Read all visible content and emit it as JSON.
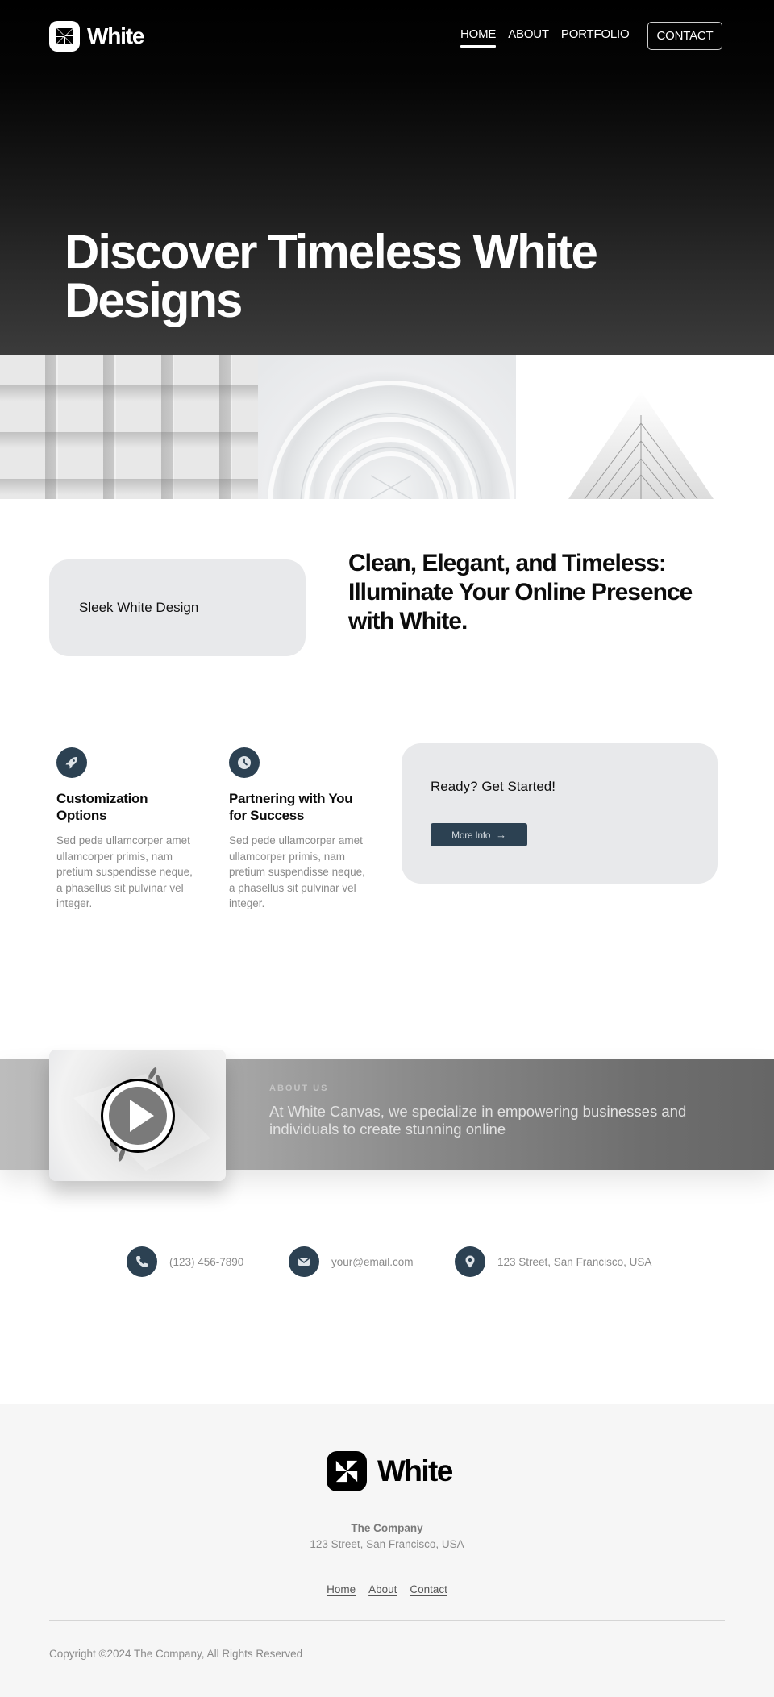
{
  "header": {
    "brand": "White",
    "nav": [
      {
        "label": "HOME",
        "active": true
      },
      {
        "label": "ABOUT",
        "active": false
      },
      {
        "label": "PORTFOLIO",
        "active": false
      }
    ],
    "contact_button": "CONTACT"
  },
  "hero": {
    "title": "Discover Timeless White Designs"
  },
  "gallery": {
    "images": [
      {
        "icon": "architecture-facade-image"
      },
      {
        "icon": "spiral-staircase-image"
      },
      {
        "icon": "skyscraper-image"
      }
    ]
  },
  "intro": {
    "pill_label": "Sleek White Design",
    "heading": "Clean, Elegant, and Timeless: Illuminate Your Online Presence with White."
  },
  "features": [
    {
      "icon": "rocket-icon",
      "title": "Customization Options",
      "text": "Sed pede ullamcorper amet ullamcorper primis, nam pretium suspendisse neque, a phasellus sit pulvinar vel integer."
    },
    {
      "icon": "clock-icon",
      "title": "Partnering with You for Success",
      "text": "Sed pede ullamcorper amet ullamcorper primis, nam pretium suspendisse neque, a phasellus sit pulvinar vel integer."
    }
  ],
  "cta": {
    "title": "Ready? Get Started!",
    "button_label": "More Info",
    "button_icon": "arrow-right-icon"
  },
  "about": {
    "label": "ABOUT US",
    "text": "At White Canvas, we specialize in empowering businesses and individuals to create stunning online"
  },
  "contacts": [
    {
      "icon": "phone-icon",
      "value": "(123) 456-7890"
    },
    {
      "icon": "envelope-icon",
      "value": "your@email.com"
    },
    {
      "icon": "map-pin-icon",
      "value": "123 Street, San Francisco, USA"
    }
  ],
  "footer": {
    "brand": "White",
    "company": "The Company",
    "address": "123 Street, San Francisco, USA",
    "links": [
      "Home",
      "About",
      "Contact"
    ],
    "copyright": "Copyright ©2024 The Company, All Rights Reserved"
  },
  "colors": {
    "accent": "#2c4152",
    "card_bg": "#e8e9eb",
    "footer_bg": "#f6f6f6",
    "muted_text": "#8a8a8a"
  }
}
